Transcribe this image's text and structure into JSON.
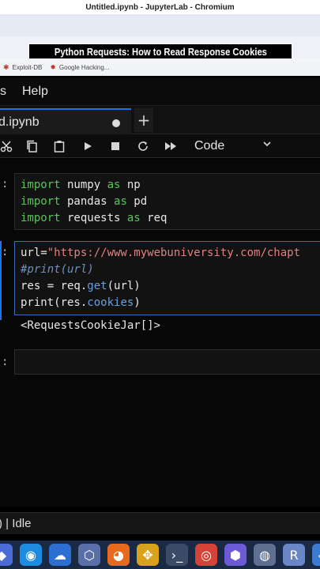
{
  "browser": {
    "window_title": "Untitled.ipynb - JupyterLab - Chromium",
    "bookmarks": [
      {
        "label": "Exploit-DB",
        "icon": "bug-icon"
      },
      {
        "label": "Google Hacking...",
        "icon": "google-hacking-icon"
      }
    ]
  },
  "overlay": {
    "caption": "Python Requests: How to Read Response Cookies"
  },
  "jupyter": {
    "menu": [
      "s",
      "Help"
    ],
    "tab": {
      "label": "d.ipynb",
      "unsaved_dot": true,
      "add_label": "+"
    },
    "toolbar": {
      "buttons": [
        "cut-icon",
        "copy-icon",
        "paste-icon",
        "run-icon",
        "stop-icon",
        "restart-icon",
        "fast-forward-icon"
      ],
      "cell_type": "Code"
    },
    "cells": [
      {
        "prompt": ":",
        "lines": [
          [
            {
              "t": "import",
              "c": "kw"
            },
            {
              "t": " numpy "
            },
            {
              "t": "as",
              "c": "kw"
            },
            {
              "t": " np"
            }
          ],
          [
            {
              "t": "import",
              "c": "kw"
            },
            {
              "t": " pandas "
            },
            {
              "t": "as",
              "c": "kw"
            },
            {
              "t": " pd"
            }
          ],
          [
            {
              "t": "import",
              "c": "kw"
            },
            {
              "t": " requests "
            },
            {
              "t": "as",
              "c": "kw"
            },
            {
              "t": " req"
            }
          ]
        ]
      },
      {
        "prompt": ":",
        "lines": [
          [
            {
              "t": "url="
            },
            {
              "t": "\"https://www.mywebuniversity.com/chapt",
              "c": "str"
            }
          ],
          [
            {
              "t": "#print(url)",
              "c": "cm"
            }
          ],
          [
            {
              "t": "res = req."
            },
            {
              "t": "get",
              "c": "fn"
            },
            {
              "t": "(url)"
            }
          ],
          [
            {
              "t": "print(res."
            },
            {
              "t": "cookies",
              "c": "fn"
            },
            {
              "t": ")"
            }
          ]
        ],
        "output": "<RequestsCookieJar[]>"
      },
      {
        "prompt": ":",
        "lines": []
      }
    ],
    "status": ") | Idle"
  },
  "taskbar": [
    {
      "icon": "app-icon-1",
      "color": "#4b6cd6"
    },
    {
      "icon": "edge-icon",
      "color": "#1c8be0"
    },
    {
      "icon": "cloud-icon",
      "color": "#2c6fd1"
    },
    {
      "icon": "cube-icon",
      "color": "#5a6fa8"
    },
    {
      "icon": "firefox-icon",
      "color": "#e86a1e"
    },
    {
      "icon": "network-icon",
      "color": "#d9a21c"
    },
    {
      "icon": "terminal-icon",
      "color": "#3b4a66"
    },
    {
      "icon": "chrome-icon",
      "color": "#d44436"
    },
    {
      "icon": "vpn-icon",
      "color": "#6c5ad6"
    },
    {
      "icon": "search-globe-icon",
      "color": "#5f6f8f"
    },
    {
      "icon": "r-icon",
      "color": "#6a86c6"
    },
    {
      "icon": "app-icon-2",
      "color": "#3a7bd5"
    }
  ]
}
